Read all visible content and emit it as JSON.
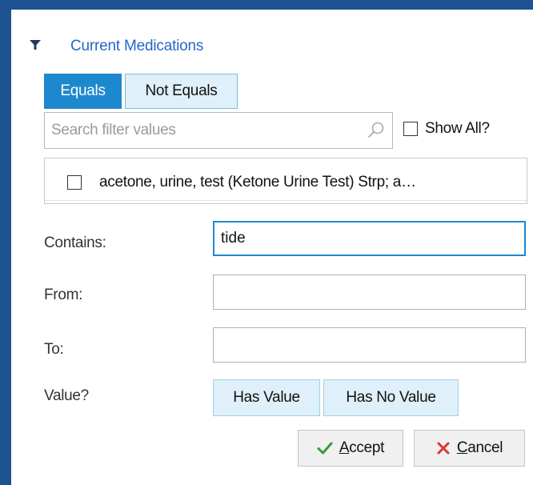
{
  "filter": {
    "title": "Current Medications",
    "match_modes": [
      "Equals",
      "Not Equals"
    ],
    "active_mode": "Equals"
  },
  "search": {
    "placeholder": "Search filter values",
    "value": ""
  },
  "show_all": {
    "label": "Show All?",
    "checked": false
  },
  "values": [
    {
      "label": "acetone, urine, test (Ketone Urine Test) Strp; a…",
      "checked": false
    }
  ],
  "fields": {
    "contains_label": "Contains:",
    "contains_value": "tide",
    "from_label": "From:",
    "from_value": "",
    "to_label": "To:",
    "to_value": "",
    "value_label": "Value?"
  },
  "value_buttons": {
    "has_value": "Has Value",
    "has_no_value": "Has No Value"
  },
  "actions": {
    "accept_key": "A",
    "accept_rest": "ccept",
    "cancel_key": "C",
    "cancel_rest": "ancel"
  },
  "colors": {
    "background": "#1d5292",
    "accent": "#1e88cf",
    "title": "#2468c8",
    "accept_check": "#3a9a3a",
    "cancel_x": "#d9382e"
  },
  "icons": [
    "filter-funnel-icon",
    "search-icon",
    "checkmark-icon",
    "x-icon"
  ]
}
